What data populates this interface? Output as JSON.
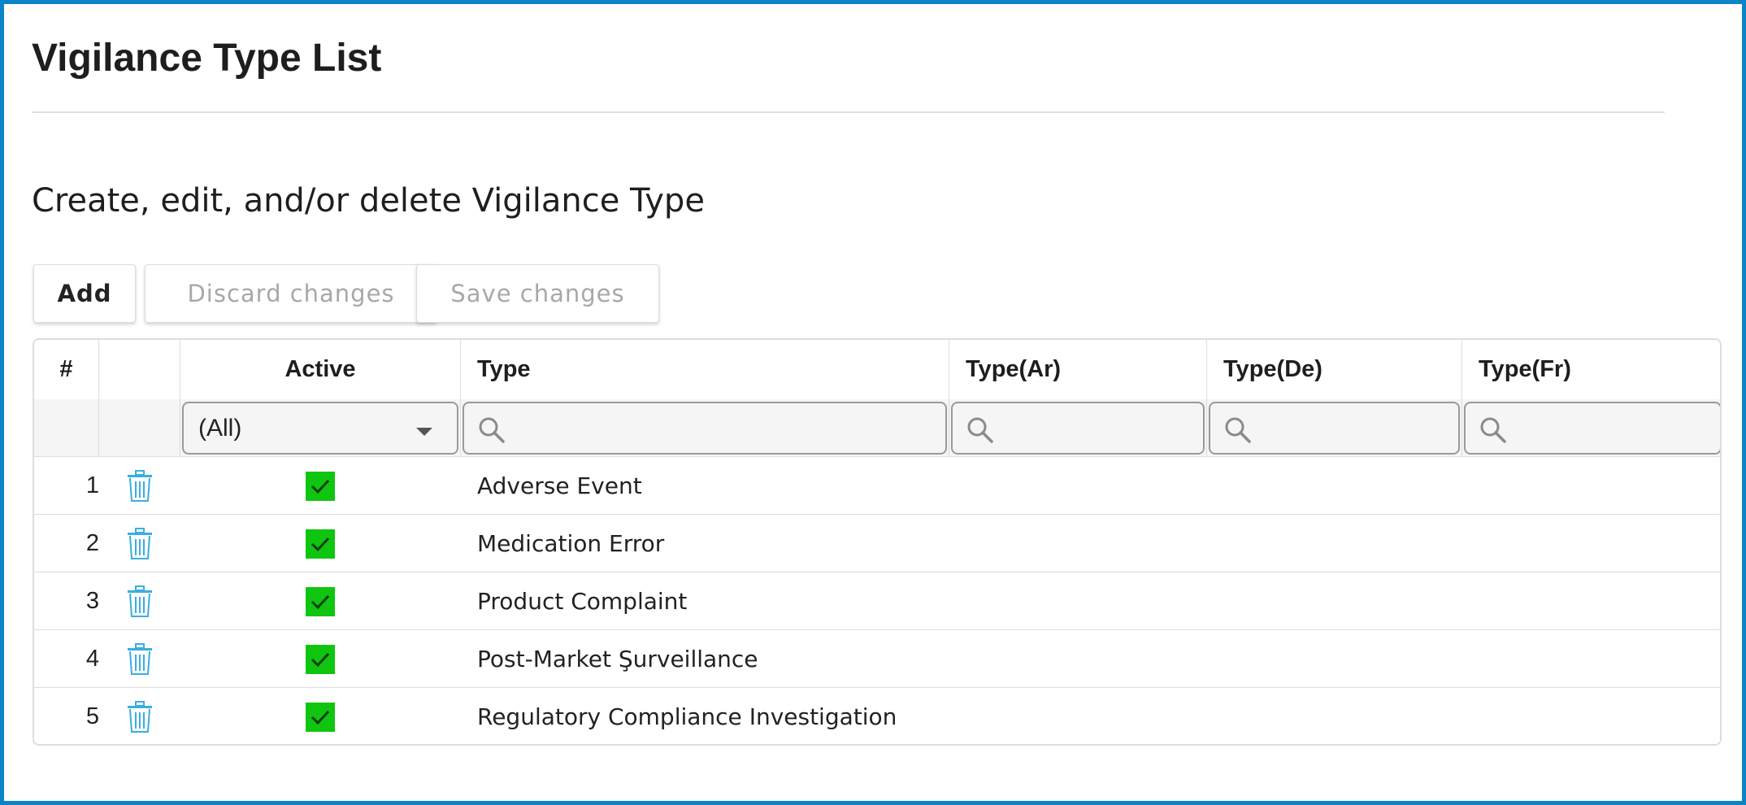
{
  "page": {
    "title": "Vigilance Type List",
    "subtitle": "Create, edit, and/or delete Vigilance Type"
  },
  "toolbar": {
    "add_label": "Add",
    "discard_label": "Discard changes",
    "save_label": "Save changes"
  },
  "grid": {
    "columns": {
      "index": "#",
      "delete": "",
      "active": "Active",
      "type": "Type",
      "type_ar": "Type(Ar)",
      "type_de": "Type(De)",
      "type_fr": "Type(Fr)"
    },
    "filters": {
      "active_selected": "(All)",
      "type_value": "",
      "type_ar_value": "",
      "type_de_value": "",
      "type_fr_value": ""
    },
    "rows": [
      {
        "index": "1",
        "active": true,
        "type": "Adverse Event",
        "type_ar": "",
        "type_de": "",
        "type_fr": ""
      },
      {
        "index": "2",
        "active": true,
        "type": "Medication Error",
        "type_ar": "",
        "type_de": "",
        "type_fr": ""
      },
      {
        "index": "3",
        "active": true,
        "type": "Product Complaint",
        "type_ar": "",
        "type_de": "",
        "type_fr": ""
      },
      {
        "index": "4",
        "active": true,
        "type": "Post-Market Şurveillance",
        "type_ar": "",
        "type_de": "",
        "type_fr": ""
      },
      {
        "index": "5",
        "active": true,
        "type": "Regulatory Compliance Investigation",
        "type_ar": "",
        "type_de": "",
        "type_fr": ""
      }
    ]
  },
  "icons": {
    "delete": "trash-icon",
    "filter": "search-icon",
    "active": "check-icon",
    "select": "caret-down-icon"
  },
  "colors": {
    "frame_border": "#0a84c6",
    "checkbox_active": "#10c510",
    "trash_icon": "#3aaee0",
    "disabled_text": "#a8a8a8"
  }
}
